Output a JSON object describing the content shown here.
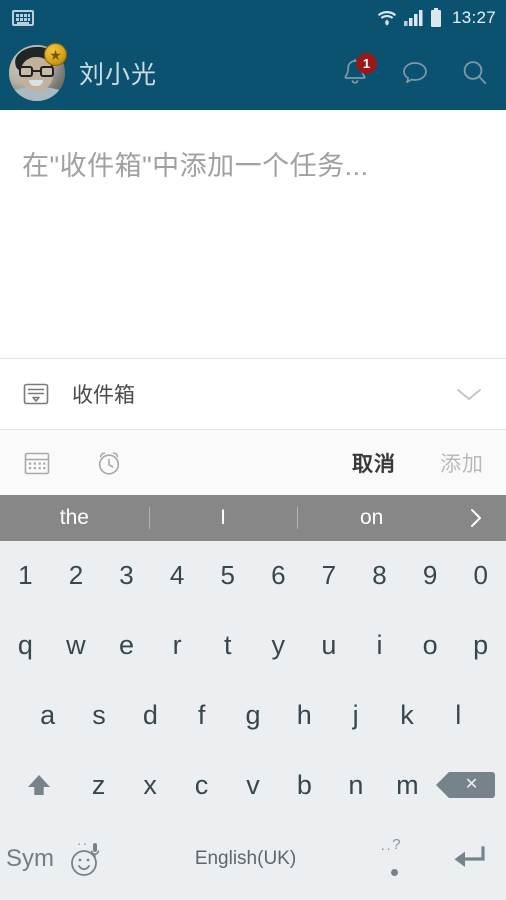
{
  "status_bar": {
    "keyboard_icon": "keyboard-indicator-icon",
    "wifi_icon": "wifi-icon",
    "signal_icon": "signal-icon",
    "battery_icon": "battery-icon",
    "time": "13:27"
  },
  "app_bar": {
    "avatar": "user-avatar",
    "premium_badge": "★",
    "username": "刘小光",
    "actions": [
      {
        "name": "notifications-bell",
        "badge": "1"
      },
      {
        "name": "messages-bubble",
        "badge": ""
      },
      {
        "name": "search",
        "badge": ""
      }
    ],
    "background_color": "#0a5270"
  },
  "task_input": {
    "placeholder": "在\"收件箱\"中添加一个任务...",
    "value": ""
  },
  "project_row": {
    "icon": "inbox-icon",
    "label": "收件箱",
    "chevron": "chevron-down-icon"
  },
  "action_bar": {
    "icons": [
      {
        "name": "calendar-icon"
      },
      {
        "name": "alarm-clock-icon"
      }
    ],
    "cancel_label": "取消",
    "add_label": "添加",
    "cancel_color": "#383838",
    "add_color": "#b9b9b9"
  },
  "keyboard": {
    "suggestion_bar": {
      "background_color": "#878787",
      "suggestions": [
        "the",
        "I",
        "on"
      ],
      "more_icon": "chevron-right-icon"
    },
    "background_color": "#eceff1",
    "key_text_color": "#37474f",
    "rows": {
      "numbers": [
        "1",
        "2",
        "3",
        "4",
        "5",
        "6",
        "7",
        "8",
        "9",
        "0"
      ],
      "row1": [
        "q",
        "w",
        "e",
        "r",
        "t",
        "y",
        "u",
        "i",
        "o",
        "p"
      ],
      "row2": [
        "a",
        "s",
        "d",
        "f",
        "g",
        "h",
        "j",
        "k",
        "l"
      ],
      "row3": [
        "z",
        "x",
        "c",
        "v",
        "b",
        "n",
        "m"
      ],
      "shift": "shift-icon",
      "backspace": "backspace-icon"
    },
    "bottom_row": {
      "sym_label": "Sym",
      "emoji_icon": "emoji-mic-icon",
      "space_label": "English(UK)",
      "period_label": ".",
      "period_hint": "?",
      "enter_icon": "enter-icon"
    }
  }
}
